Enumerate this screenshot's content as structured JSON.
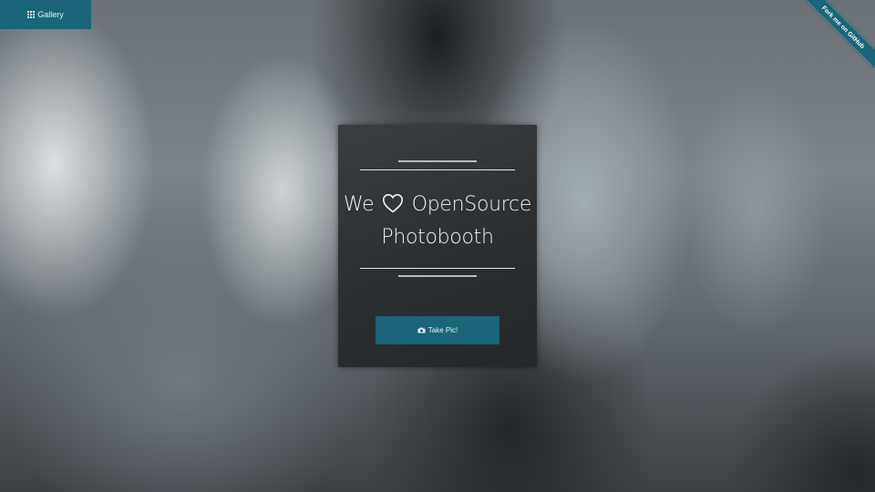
{
  "nav": {
    "gallery_label": "Gallery",
    "gallery_icon": "grid-icon"
  },
  "ribbon": {
    "label": "Fork me on GitHub"
  },
  "card": {
    "title_we": "We",
    "title_heart_icon": "heart-icon",
    "title_rest": "OpenSource",
    "title_line2": "Photobooth",
    "button_label": "Take Pic!",
    "button_icon": "camera-icon"
  },
  "colors": {
    "accent": "#1a6577",
    "card_background": "#2f3235",
    "text": "#ffffff"
  }
}
